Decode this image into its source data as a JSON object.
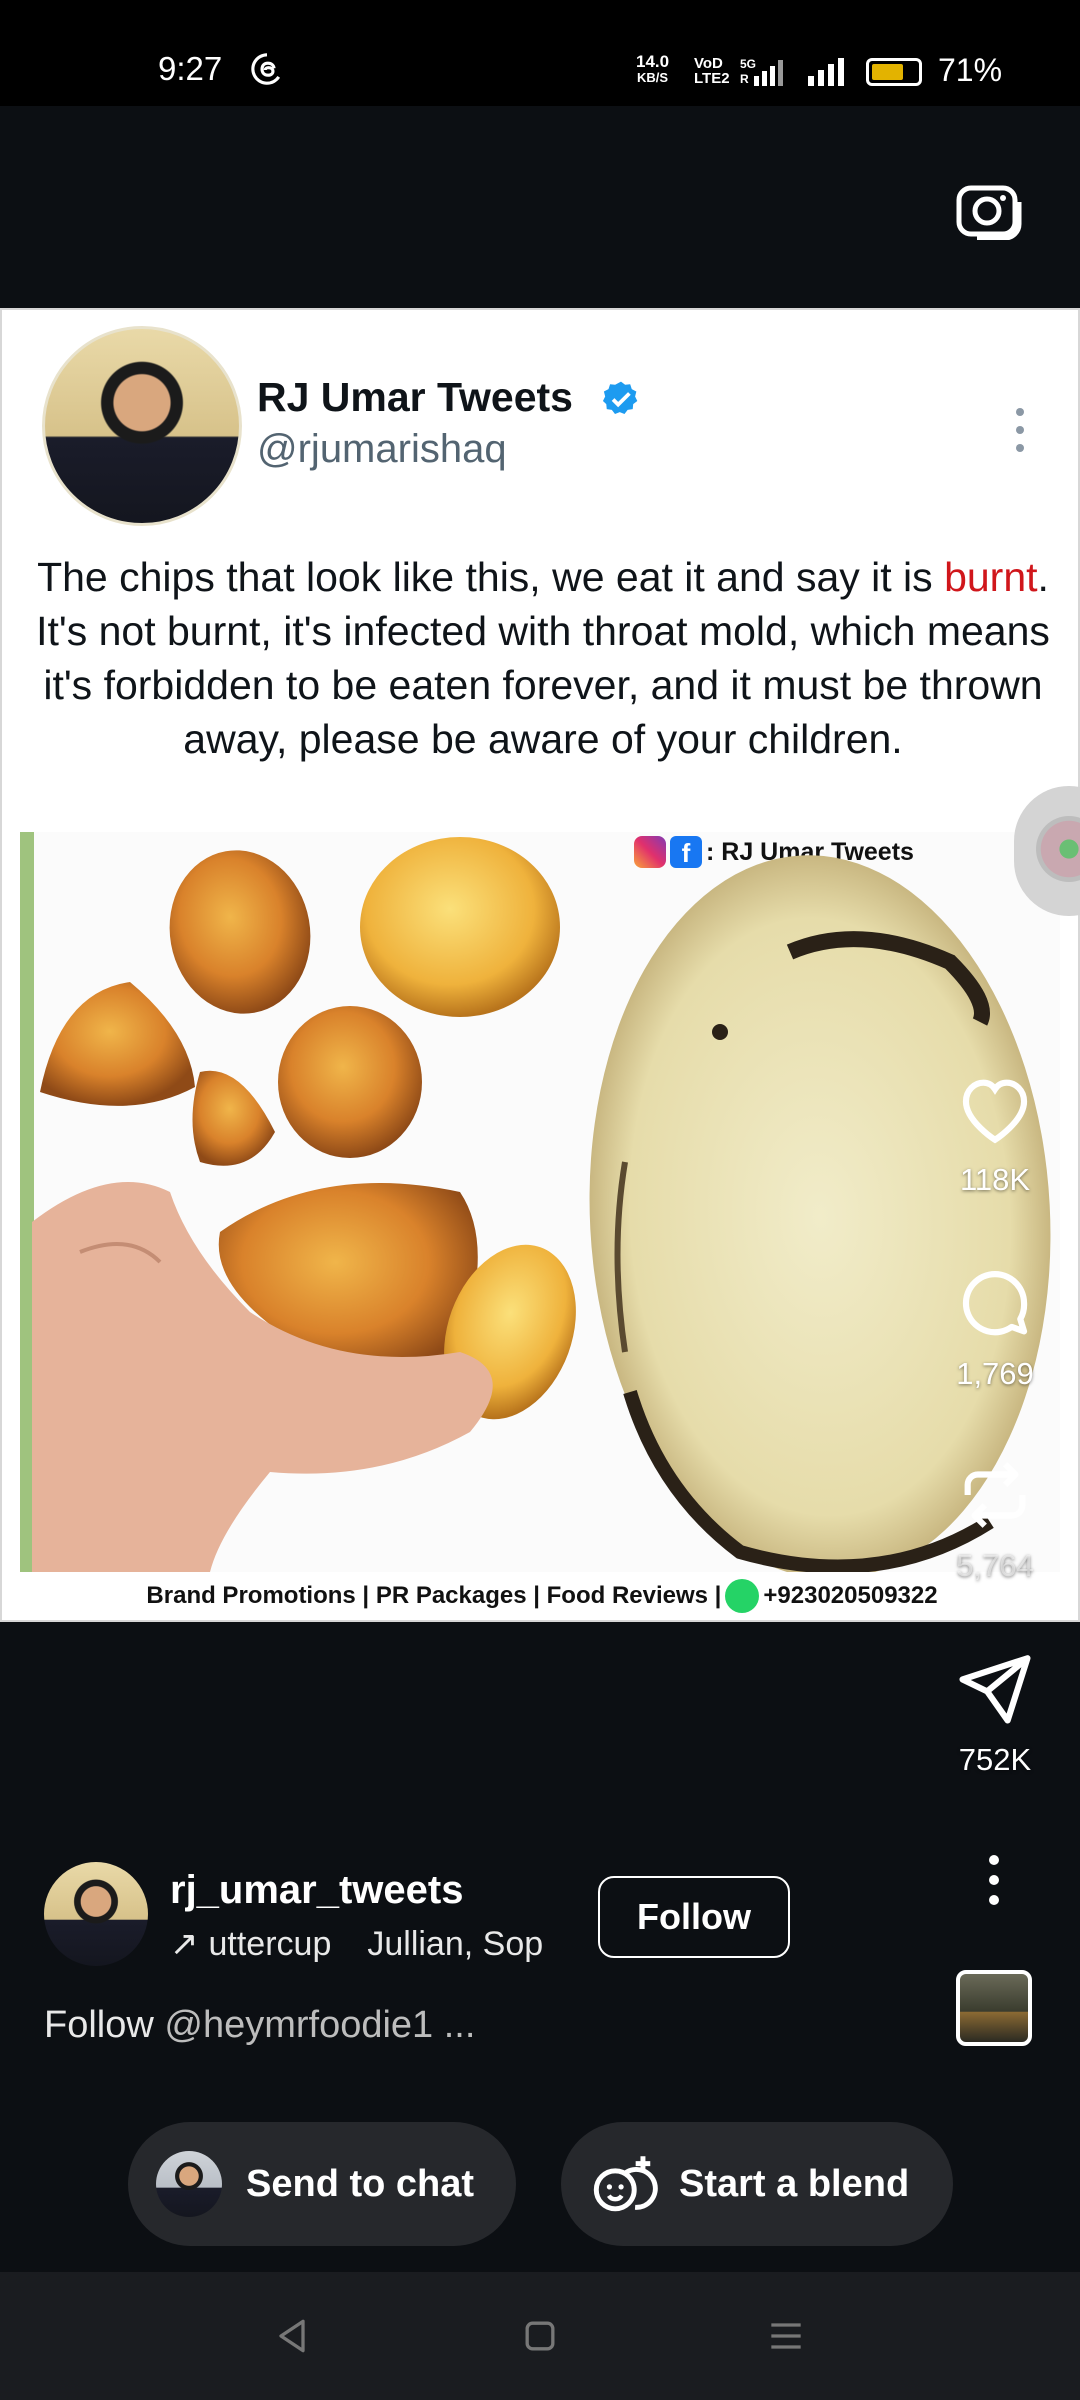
{
  "status_bar": {
    "time": "9:27",
    "net_speed_value": "14.0",
    "net_speed_unit": "KB/S",
    "volte_top": "VoD",
    "volte_bottom": "LTE2",
    "network": "5G",
    "battery_pct": "71%",
    "battery_level": 0.71
  },
  "post": {
    "author_name": "RJ Umar Tweets",
    "author_handle": "@rjumarishaq",
    "text_before": "The chips that look like this, we eat it and say it is ",
    "text_highlight": "burnt",
    "text_after": ". It's not burnt, it's infected with throat mold, which means it's forbidden to be eaten forever, and it must be thrown away, please be aware of your children.",
    "social_tag": ": RJ Umar Tweets",
    "footer": "Brand Promotions | PR Packages | Food Reviews |",
    "footer_phone": "+923020509322"
  },
  "actions": {
    "likes": "118K",
    "comments": "1,769",
    "reposts": "5,764",
    "shares": "752K"
  },
  "reel": {
    "username": "rj_umar_tweets",
    "audio_track": "uttercup",
    "audio_artist": "Jullian, Sop",
    "follow_label": "Follow",
    "caption_prefix": "Follow ",
    "caption_tag": "@heymrfoodie1 ..."
  },
  "bottom_actions": {
    "send_to_chat": "Send to chat",
    "start_blend": "Start a blend"
  },
  "colors": {
    "highlight_red": "#d0161b",
    "verified_blue": "#1d9bf0",
    "background": "#0c0f13"
  }
}
